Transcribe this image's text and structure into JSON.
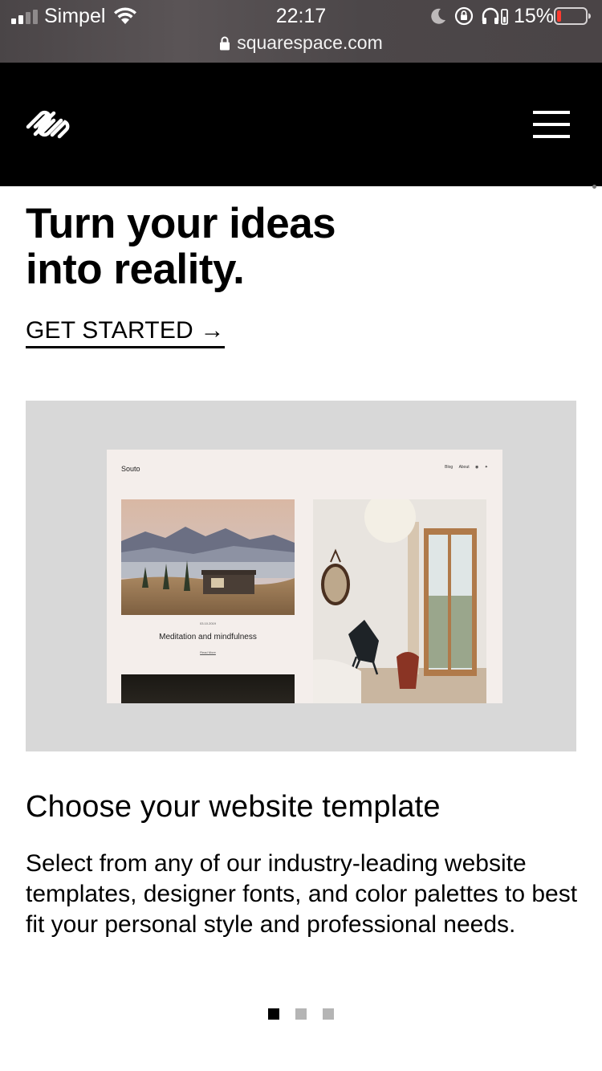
{
  "status_bar": {
    "carrier": "Simpel",
    "time": "22:17",
    "battery_percent": "15%",
    "battery_level": 0.15,
    "url": "squarespace.com"
  },
  "header": {
    "logo_icon": "squarespace-logo-icon",
    "menu_icon": "hamburger-menu-icon"
  },
  "hero": {
    "title_line1": "Turn your ideas",
    "title_line2": "into reality.",
    "cta_label": "GET STARTED →"
  },
  "template_preview": {
    "brand": "Souto",
    "nav_items": [
      "Blog",
      "About"
    ],
    "post_date": "03.10.2019",
    "post_title": "Meditation and mindfulness",
    "read_more": "Read More"
  },
  "feature": {
    "title": "Choose your website template",
    "body": "Select from any of our industry-leading website templates, designer fonts, and color palettes to best fit your personal style and professional needs."
  },
  "pager": {
    "count": 3,
    "active_index": 0,
    "colors": {
      "active": "#000000",
      "inactive": "#b5b5b5"
    }
  },
  "colors": {
    "header_bg": "#000000",
    "showcase_bg": "#d8d8d8",
    "preview_bg": "#f4eeeb",
    "battery_low": "#ff3b30"
  }
}
